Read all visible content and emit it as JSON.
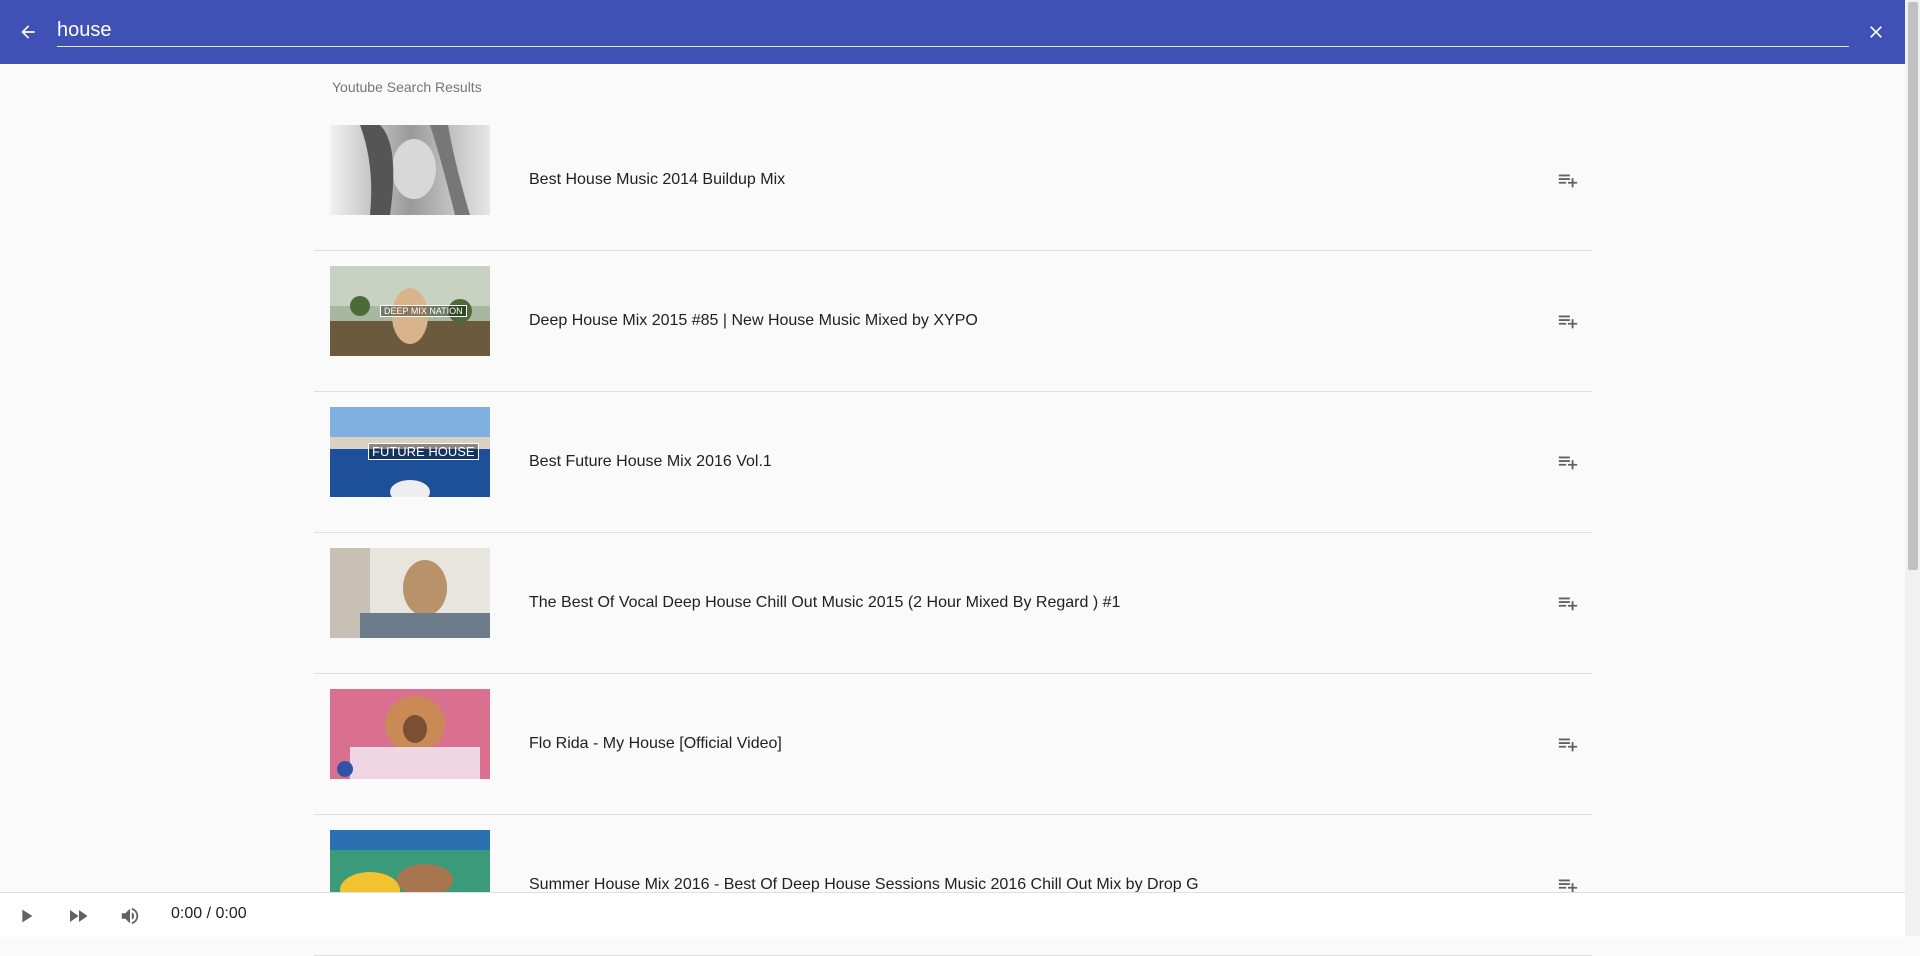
{
  "search": {
    "query": "house"
  },
  "results": {
    "subheader": "Youtube Search Results",
    "items": [
      {
        "title": "Best House Music 2014 Buildup Mix",
        "overlay": ""
      },
      {
        "title": "Deep House Mix 2015 #85 | New House Music Mixed by XYPO",
        "overlay": "DEEP MIX NATION"
      },
      {
        "title": "Best Future House Mix 2016 Vol.1",
        "overlay": "FUTURE HOUSE"
      },
      {
        "title": "The Best Of Vocal Deep House Chill Out Music 2015 (2 Hour Mixed By Regard ) #1",
        "overlay": ""
      },
      {
        "title": "Flo Rida - My House [Official Video]",
        "overlay": ""
      },
      {
        "title": "Summer House Mix 2016 - Best Of Deep House Sessions Music 2016 Chill Out Mix by Drop G",
        "overlay": ""
      }
    ]
  },
  "player": {
    "time": "0:00 / 0:00"
  },
  "colors": {
    "appbar": "#3f51b5",
    "background": "#fafafa",
    "divider": "#e0e0e0"
  },
  "icons": {
    "back": "arrow-back-icon",
    "close": "close-icon",
    "add": "playlist-add-icon",
    "play": "play-icon",
    "next": "fast-forward-icon",
    "volume": "volume-icon"
  }
}
